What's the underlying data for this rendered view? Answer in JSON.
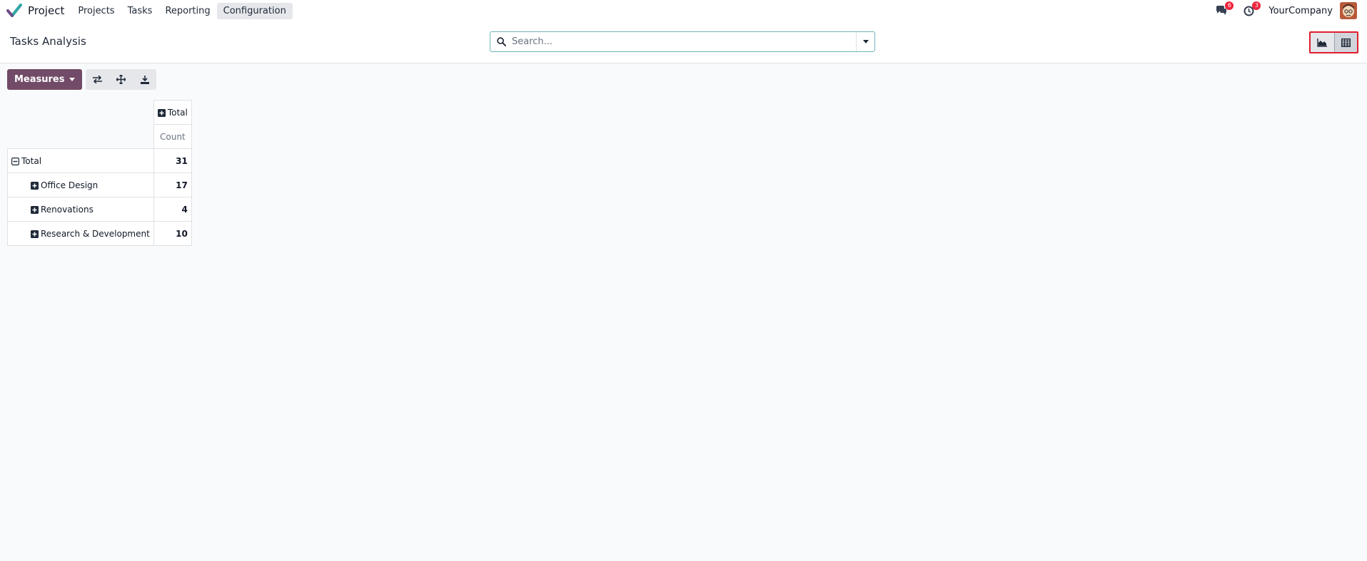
{
  "navbar": {
    "app_name": "Project",
    "menu": [
      {
        "label": "Projects"
      },
      {
        "label": "Tasks"
      },
      {
        "label": "Reporting"
      },
      {
        "label": "Configuration"
      }
    ],
    "messages_count": "6",
    "activities_count": "3",
    "company": "YourCompany"
  },
  "control": {
    "title": "Tasks Analysis",
    "search_placeholder": "Search..."
  },
  "toolbar": {
    "measures_label": "Measures"
  },
  "pivot": {
    "col_header": "Total",
    "measure": "Count",
    "total_label": "Total",
    "total_value": "31",
    "rows": [
      {
        "label": "Office Design",
        "value": "17"
      },
      {
        "label": "Renovations",
        "value": "4"
      },
      {
        "label": "Research & Development",
        "value": "10"
      }
    ]
  },
  "colors": {
    "brand": "#714b67",
    "accent": "#71b4b8",
    "badge": "#ef233c",
    "highlight": "#e11d2e"
  }
}
